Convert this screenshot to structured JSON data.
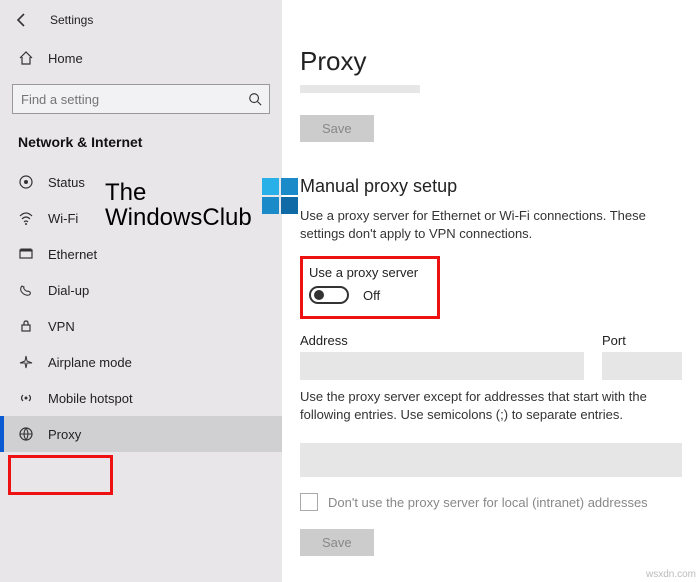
{
  "window": {
    "title": "Settings"
  },
  "sidebar": {
    "home": "Home",
    "search_placeholder": "Find a setting",
    "category": "Network & Internet",
    "items": [
      {
        "label": "Status"
      },
      {
        "label": "Wi-Fi"
      },
      {
        "label": "Ethernet"
      },
      {
        "label": "Dial-up"
      },
      {
        "label": "VPN"
      },
      {
        "label": "Airplane mode"
      },
      {
        "label": "Mobile hotspot"
      },
      {
        "label": "Proxy"
      }
    ]
  },
  "main": {
    "title": "Proxy",
    "save1": "Save",
    "section_heading": "Manual proxy setup",
    "section_desc": "Use a proxy server for Ethernet or Wi-Fi connections. These settings don't apply to VPN connections.",
    "toggle_label": "Use a proxy server",
    "toggle_state": "Off",
    "address_label": "Address",
    "port_label": "Port",
    "excl_desc": "Use the proxy server except for addresses that start with the following entries. Use semicolons (;) to separate entries.",
    "chk_label": "Don't use the proxy server for local (intranet) addresses",
    "save2": "Save"
  },
  "watermark": {
    "line1": "The",
    "line2": "WindowsClub"
  },
  "footer": "wsxdn.com"
}
